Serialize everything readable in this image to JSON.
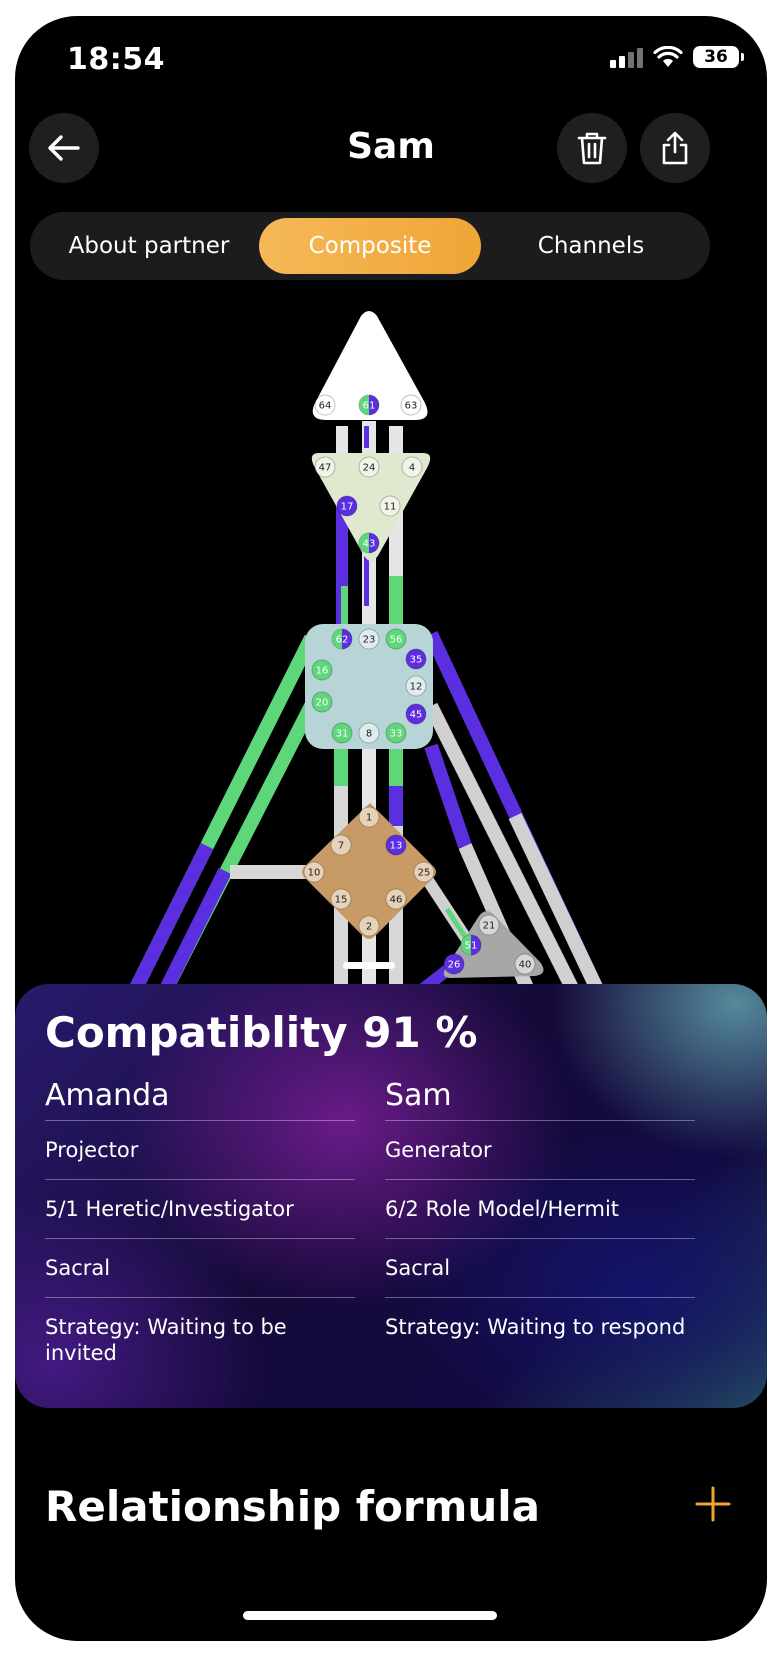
{
  "status": {
    "time": "18:54",
    "battery": "36"
  },
  "header": {
    "title": "Sam"
  },
  "tabs": [
    {
      "label": "About partner",
      "active": false
    },
    {
      "label": "Composite",
      "active": true
    },
    {
      "label": "Channels",
      "active": false
    }
  ],
  "bodygraph": {
    "gates": {
      "head": [
        "64",
        "61",
        "63"
      ],
      "ajna": [
        "47",
        "24",
        "4",
        "17",
        "11",
        "43"
      ],
      "throat": [
        "62",
        "23",
        "56",
        "16",
        "35",
        "12",
        "20",
        "45",
        "31",
        "8",
        "33"
      ],
      "g": [
        "1",
        "7",
        "13",
        "10",
        "25",
        "15",
        "46",
        "2"
      ],
      "ego": [
        "21",
        "51",
        "26",
        "40"
      ]
    },
    "colors": {
      "person_a": "#5ed77a",
      "person_b": "#5b2fe0",
      "neutral": "#d0d0d0"
    }
  },
  "compatibility": {
    "title": "Compatiblity 91 %",
    "left": {
      "name": "Amanda",
      "rows": [
        "Projector",
        "5/1 Heretic/Investigator",
        "Sacral",
        "Strategy: Waiting to be invited"
      ]
    },
    "right": {
      "name": "Sam",
      "rows": [
        "Generator",
        "6/2 Role Model/Hermit",
        "Sacral",
        "Strategy: Waiting to respond"
      ]
    }
  },
  "formula": {
    "title": "Relationship formula"
  },
  "icons": {
    "back": "arrow-left-icon",
    "delete": "trash-icon",
    "share": "share-icon",
    "add": "plus-icon"
  },
  "accent": "#f0a535"
}
